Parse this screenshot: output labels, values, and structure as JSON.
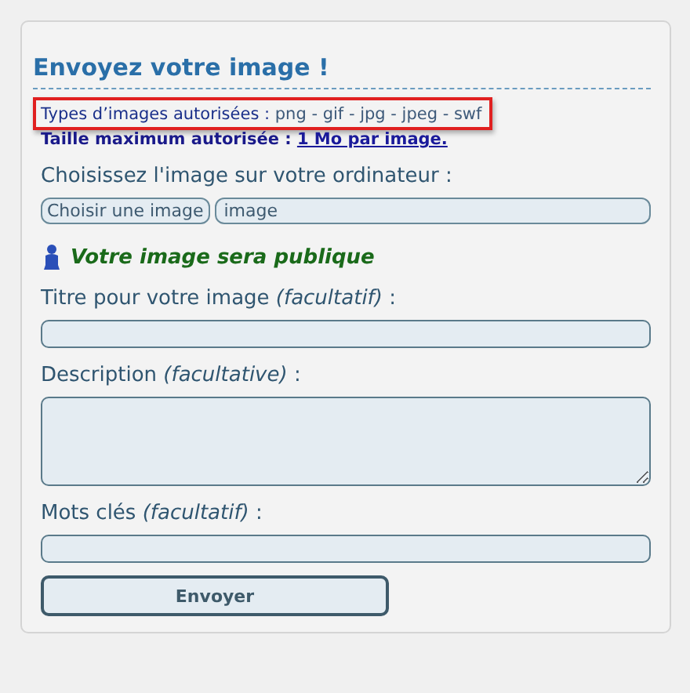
{
  "title": "Envoyez votre image !",
  "types": {
    "label": "Types d’images autorisées :",
    "value": "png - gif - jpg - jpeg - swf",
    "highlighted": true
  },
  "max_size": {
    "label": "Taille maximum autorisée :",
    "link": "1 Mo par image."
  },
  "choose": {
    "label": "Choisissez l'image sur votre ordinateur :",
    "button": "Choisir une image",
    "value": "image"
  },
  "public_notice": "Votre image sera publique",
  "fields": [
    {
      "kind": "input",
      "label": "Titre pour votre image *(facultatif)* :"
    },
    {
      "kind": "textarea",
      "label": "Description *(facultative)* :"
    },
    {
      "kind": "input",
      "label": "Mots clés *(facultatif)* :"
    }
  ],
  "submit": "Envoyer"
}
